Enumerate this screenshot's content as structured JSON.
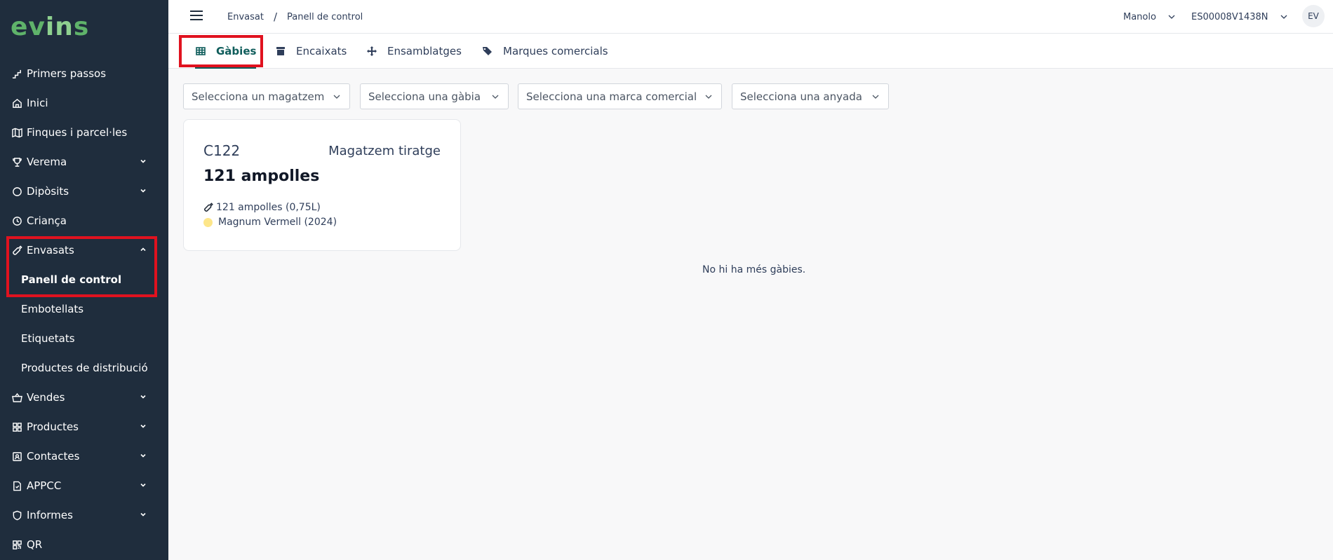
{
  "app": {
    "logo": "evins"
  },
  "sidebar": {
    "items": [
      {
        "label": "Primers passos"
      },
      {
        "label": "Inici"
      },
      {
        "label": "Finques i parcel·les"
      },
      {
        "label": "Verema"
      },
      {
        "label": "Dipòsits"
      },
      {
        "label": "Criança"
      },
      {
        "label": "Envasats"
      },
      {
        "label": "Vendes"
      },
      {
        "label": "Productes"
      },
      {
        "label": "Contactes"
      },
      {
        "label": "APPCC"
      },
      {
        "label": "Informes"
      },
      {
        "label": "QR"
      }
    ],
    "envasats_sub": [
      {
        "label": "Panell de control"
      },
      {
        "label": "Embotellats"
      },
      {
        "label": "Etiquetats"
      },
      {
        "label": "Productes de distribució"
      }
    ]
  },
  "header": {
    "breadcrumb": [
      "Envasat",
      "Panell de control"
    ],
    "user": "Manolo",
    "company": "ES00008V1438N",
    "avatar": "EV"
  },
  "tabs": [
    {
      "label": "Gàbies"
    },
    {
      "label": "Encaixats"
    },
    {
      "label": "Ensamblatges"
    },
    {
      "label": "Marques comercials"
    }
  ],
  "filters": {
    "warehouse": "Selecciona un magatzem",
    "cage": "Selecciona una gàbia",
    "brand": "Selecciona una marca comercial",
    "vintage": "Selecciona una anyada"
  },
  "card": {
    "code": "C122",
    "warehouse": "Magatzem tiratge",
    "quantity": "121 ampolles",
    "detail": "121 ampolles (0,75L)",
    "product": "Magnum Vermell (2024)",
    "product_color": "#fde68a"
  },
  "empty_text": "No hi ha més gàbies.",
  "colors": {
    "sidebar_bg": "#1f2d3d",
    "accent": "#0f5d5b",
    "highlight": "#e0121f"
  }
}
